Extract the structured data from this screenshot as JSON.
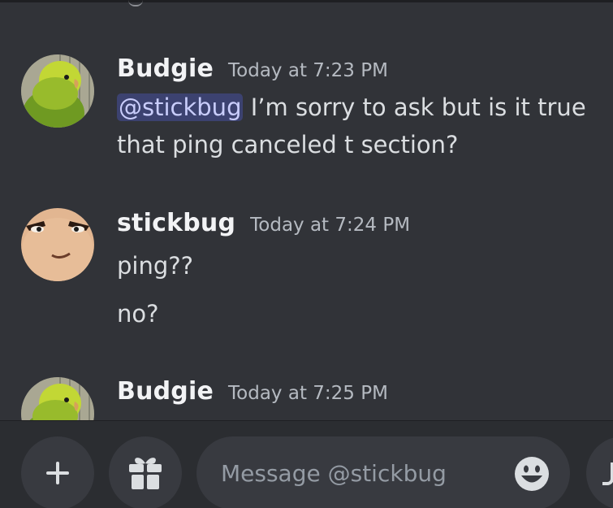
{
  "conversation": {
    "messages": [
      {
        "author": "Budgie",
        "timestamp": "Today at 7:23 PM",
        "avatar_icon": "budgie-parakeet-avatar",
        "lines": [
          {
            "mention": "@stickbug",
            "text": " I’m sorry to ask but is it true"
          },
          {
            "text": "that ping canceled t section?"
          }
        ]
      },
      {
        "author": "stickbug",
        "timestamp": "Today at 7:24 PM",
        "avatar_icon": "roblox-face-avatar",
        "lines": [
          {
            "text": "ping??"
          },
          {
            "text": "no?"
          }
        ]
      },
      {
        "author": "Budgie",
        "timestamp": "Today at 7:25 PM",
        "avatar_icon": "budgie-parakeet-avatar"
      }
    ]
  },
  "composer": {
    "placeholder": "Message @stickbug",
    "buttons": [
      "plus-icon",
      "gift-icon",
      "emoji-icon"
    ]
  },
  "colors": {
    "background": "#313338",
    "composer_background": "#2b2d31",
    "input_background": "#383a40",
    "mention_background": "#3c4270",
    "mention_text": "#c9cdfb"
  }
}
